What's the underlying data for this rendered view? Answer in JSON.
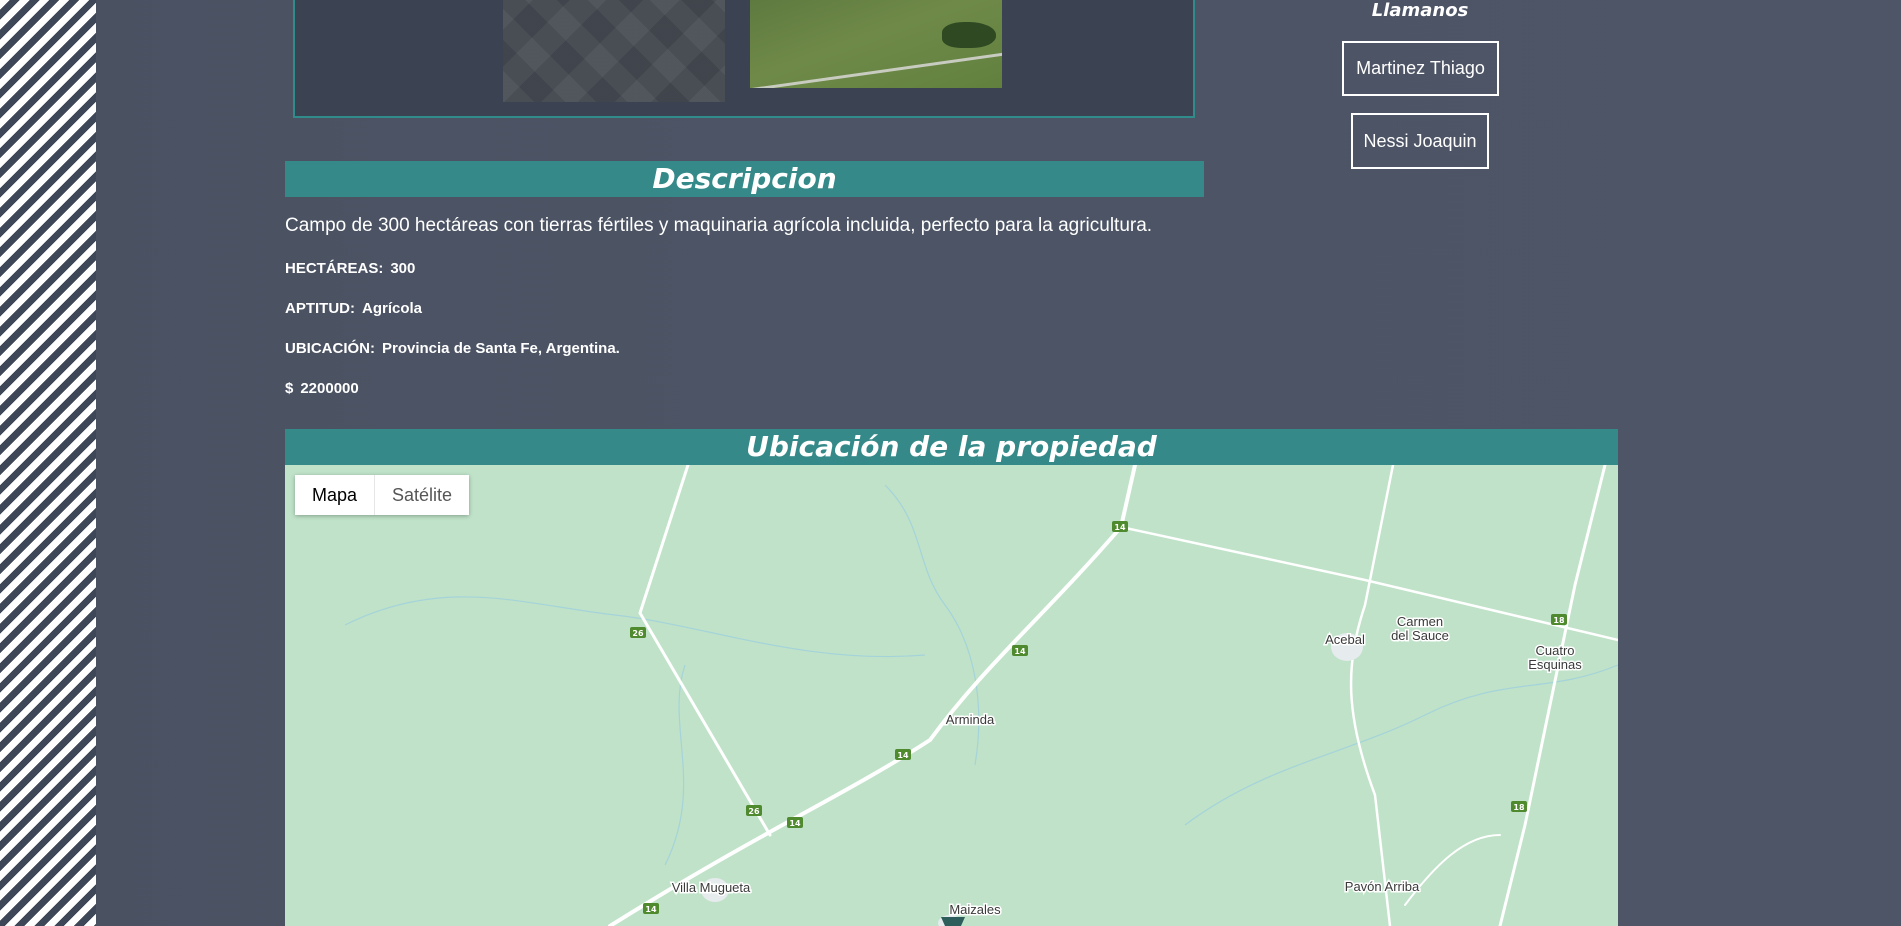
{
  "contact": {
    "title": "Llamanos",
    "agents": [
      "Martinez Thiago",
      "Nessi Joaquin"
    ]
  },
  "description": {
    "heading": "Descripcion",
    "text": "Campo de 300 hectáreas con tierras fértiles y maquinaria agrícola incluida, perfecto para la agricultura.",
    "hectares_label": "HECTÁREAS:",
    "hectares_value": "300",
    "aptitude_label": "APTITUD:",
    "aptitude_value": "Agrícola",
    "location_label": "UBICACIÓN:",
    "location_value": "Provincia de Santa Fe, Argentina.",
    "price_label": "$",
    "price_value": "2200000"
  },
  "map_section": {
    "heading": "Ubicación de la propiedad",
    "map_type_buttons": [
      "Mapa",
      "Satélite"
    ],
    "active_map_type": "Mapa",
    "places": [
      "Acebal",
      "Carmen",
      "del Sauce",
      "Cuatro",
      "Esquinas",
      "Arminda",
      "Villa Mugueta",
      "Maizales",
      "Pavón Arriba"
    ],
    "route_shields": [
      "14",
      "14",
      "14",
      "14",
      "14",
      "26",
      "26",
      "18",
      "18"
    ]
  },
  "colors": {
    "accent": "#358a89",
    "background": "#4b5364",
    "map_land": "#bfe2c8",
    "route_shield": "#4f8a2f"
  }
}
